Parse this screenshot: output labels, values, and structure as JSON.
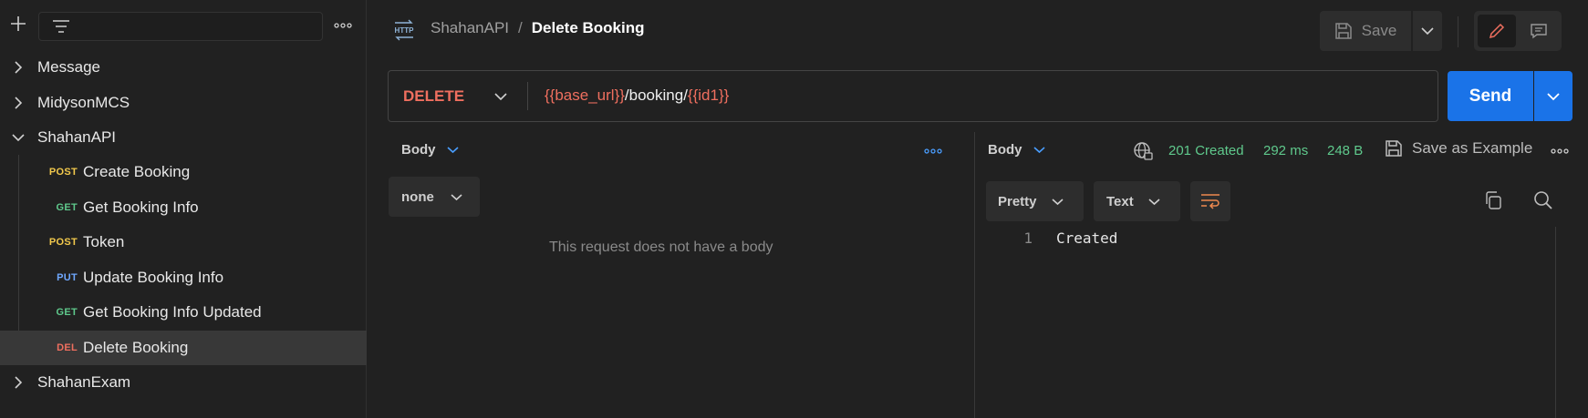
{
  "sidebar": {
    "tree": [
      {
        "label": "Message",
        "expanded": false
      },
      {
        "label": "MidysonMCS",
        "expanded": false
      },
      {
        "label": "ShahanAPI",
        "expanded": true
      },
      {
        "label": "ShahanExam",
        "expanded": false
      }
    ],
    "requests": [
      {
        "method": "POST",
        "label": "Create Booking"
      },
      {
        "method": "GET",
        "label": "Get Booking Info"
      },
      {
        "method": "POST",
        "label": "Token"
      },
      {
        "method": "PUT",
        "label": "Update Booking Info"
      },
      {
        "method": "GET",
        "label": "Get Booking Info Updated"
      },
      {
        "method": "DEL",
        "label": "Delete Booking",
        "selected": true
      }
    ]
  },
  "header": {
    "icon": "http-icon",
    "parent": "ShahanAPI",
    "separator": "/",
    "current": "Delete Booking",
    "save_label": "Save"
  },
  "request": {
    "method": "DELETE",
    "url_parts": [
      "{{base_url}}",
      "/booking/",
      "{{id1}}"
    ],
    "send_label": "Send",
    "body_tab": "Body",
    "body_type": "none",
    "empty_message": "This request does not have a body"
  },
  "response": {
    "body_tab": "Body",
    "status": "201 Created",
    "time": "292 ms",
    "size": "248 B",
    "save_example_label": "Save as Example",
    "format": "Pretty",
    "language": "Text",
    "lines": [
      {
        "number": "1",
        "text": "Created"
      }
    ]
  },
  "colors": {
    "post": "#f2c94c",
    "get": "#5fc98c",
    "put": "#6fa8ff",
    "delete": "#ef6f5f",
    "send": "#1a73e8",
    "status_ok": "#5fc98c"
  }
}
